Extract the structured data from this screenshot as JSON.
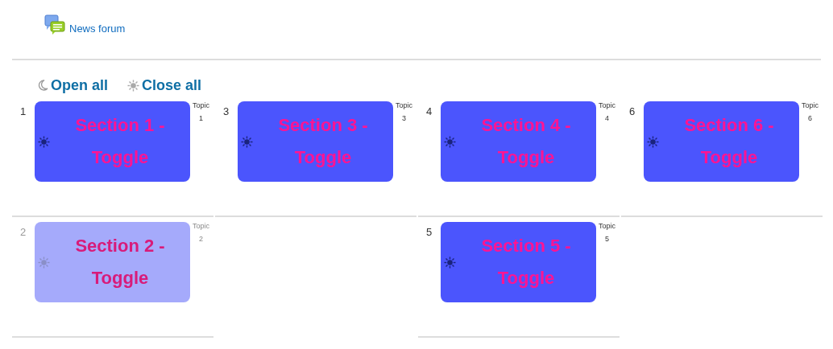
{
  "activity": {
    "label": "News forum"
  },
  "controls": [
    {
      "kind": "open",
      "label": "Open all"
    },
    {
      "kind": "close",
      "label": "Close all"
    }
  ],
  "grid": [
    {
      "kind": "section",
      "number": "1",
      "title": "Section 1 - Toggle",
      "topic_label": "Topic",
      "topic_number": "1",
      "dimmed": false
    },
    {
      "kind": "section",
      "number": "3",
      "title": "Section 3 - Toggle",
      "topic_label": "Topic",
      "topic_number": "3",
      "dimmed": false
    },
    {
      "kind": "section",
      "number": "4",
      "title": "Section 4 - Toggle",
      "topic_label": "Topic",
      "topic_number": "4",
      "dimmed": false
    },
    {
      "kind": "section",
      "number": "6",
      "title": "Section 6 - Toggle",
      "topic_label": "Topic",
      "topic_number": "6",
      "dimmed": false
    },
    {
      "kind": "section",
      "number": "2",
      "title": "Section 2 - Toggle",
      "topic_label": "Topic",
      "topic_number": "2",
      "dimmed": true
    },
    {
      "kind": "empty"
    },
    {
      "kind": "section",
      "number": "5",
      "title": "Section 5 - Toggle",
      "topic_label": "Topic",
      "topic_number": "5",
      "dimmed": false
    },
    {
      "kind": "empty"
    }
  ]
}
